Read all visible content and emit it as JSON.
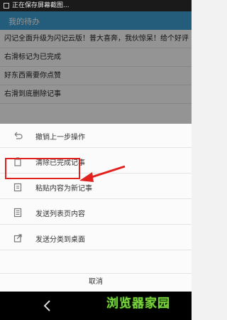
{
  "status_bar": {
    "text": "正在保存屏幕截图..."
  },
  "app_bar": {
    "title": "我的待办",
    "actions": ""
  },
  "notes": [
    "闪记全面升级为闪记云版！普大喜奔，我伙惊呆！给个好评",
    "右滑标记为已完成",
    "好东西需要你点赞",
    "右滑到底删除记事"
  ],
  "menu": {
    "items": [
      {
        "label": "撤销上一步操作",
        "icon": "undo-icon"
      },
      {
        "label": "清除已完成记事",
        "icon": "trash-icon"
      },
      {
        "label": "粘贴内容为新记事",
        "icon": "clipboard-icon"
      },
      {
        "label": "发送列表页内容",
        "icon": "list-icon"
      },
      {
        "label": "发送分类到桌面",
        "icon": "share-icon"
      }
    ],
    "cancel_label": "取消"
  },
  "watermark": "浏览器家园",
  "colors": {
    "app_bar": "#3ea0d6",
    "highlight": "#e0211d",
    "watermark": "#7ad33c"
  }
}
